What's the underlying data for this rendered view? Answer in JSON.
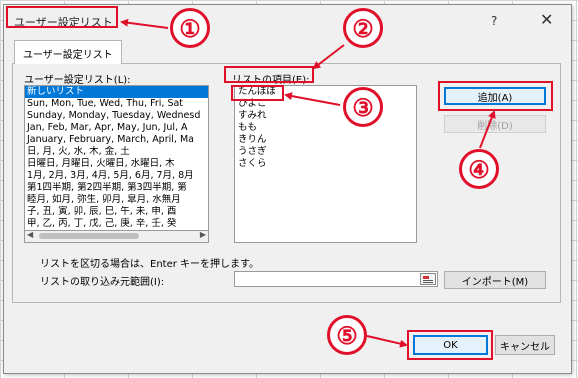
{
  "dialog": {
    "title": "ユーザー設定リスト",
    "help_symbol": "?",
    "close_symbol": "✕",
    "tab_label": "ユーザー設定リスト"
  },
  "custom_lists": {
    "label": "ユーザー設定リスト(L):",
    "items": [
      "新しいリスト",
      "Sun, Mon, Tue, Wed, Thu, Fri, Sat",
      "Sunday, Monday, Tuesday, Wednesd",
      "Jan, Feb, Mar, Apr, May, Jun, Jul, A",
      "January, February, March, April, Ma",
      "日, 月, 火, 水, 木, 金, 土",
      "日曜日, 月曜日, 火曜日, 水曜日, 木",
      "1月, 2月, 3月, 4月, 5月, 6月, 7月, 8月",
      "第1四半期, 第2四半期, 第3四半期, 第",
      "睦月, 如月, 弥生, 卯月, 皐月, 水無月",
      "子, 丑, 寅, 卯, 辰, 巳, 午, 未, 申, 酉",
      "甲, 乙, 丙, 丁, 戊, 己, 庚, 辛, 壬, 癸"
    ],
    "selected_index": 0
  },
  "list_entries": {
    "label": "リストの項目(E):",
    "items": [
      "たんぽぽ",
      "ひよこ",
      "すみれ",
      "もも",
      "きりん",
      "うさぎ",
      "さくら"
    ]
  },
  "buttons": {
    "add": "追加(A)",
    "delete": "削除(D)",
    "import": "インポート(M)",
    "ok": "OK",
    "cancel": "キャンセル"
  },
  "hint_text": "リストを区切る場合は、Enter キーを押します。",
  "import_range_label": "リストの取り込み元範囲(I):",
  "import_range_value": "",
  "callouts": [
    "①",
    "②",
    "③",
    "④",
    "⑤"
  ],
  "colors": {
    "accent": "#0078d7",
    "annotation": "#e0102a"
  }
}
